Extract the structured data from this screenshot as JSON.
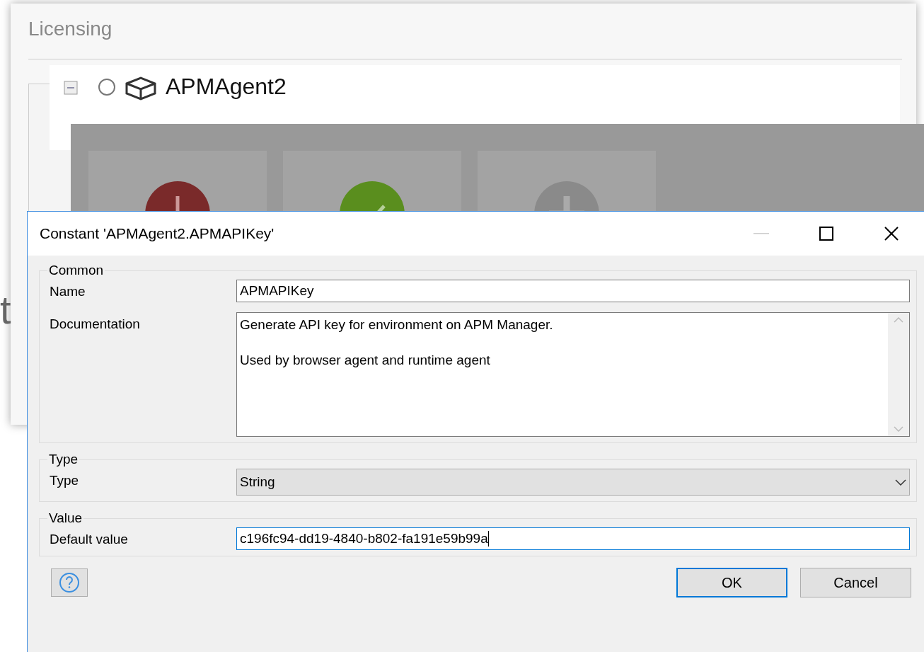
{
  "background_window": {
    "title": "Licensing",
    "tree": [
      {
        "label": "APMAgent2",
        "expanded": true
      }
    ]
  },
  "overlay_tiles": [
    {
      "kind": "error"
    },
    {
      "kind": "success"
    },
    {
      "kind": "add"
    }
  ],
  "side_text": "t",
  "dialog": {
    "title": "Constant 'APMAgent2.APMAPIKey'",
    "groups": [
      {
        "title": "Common",
        "fields": [
          {
            "kind": "text",
            "label": "Name",
            "value": "APMAPIKey",
            "focused": false
          },
          {
            "kind": "textarea",
            "label": "Documentation",
            "value": "Generate API key for environment on APM Manager.\n\nUsed by browser agent and runtime agent"
          }
        ]
      },
      {
        "title": "Type",
        "fields": [
          {
            "kind": "select",
            "label": "Type",
            "value": "String"
          }
        ]
      },
      {
        "title": "Value",
        "fields": [
          {
            "kind": "text",
            "label": "Default value",
            "value": "c196fc94-dd19-4840-b802-fa191e59b99a",
            "focused": true
          }
        ]
      }
    ],
    "buttons": [
      {
        "label": "OK",
        "default": true
      },
      {
        "label": "Cancel",
        "default": false
      }
    ]
  }
}
